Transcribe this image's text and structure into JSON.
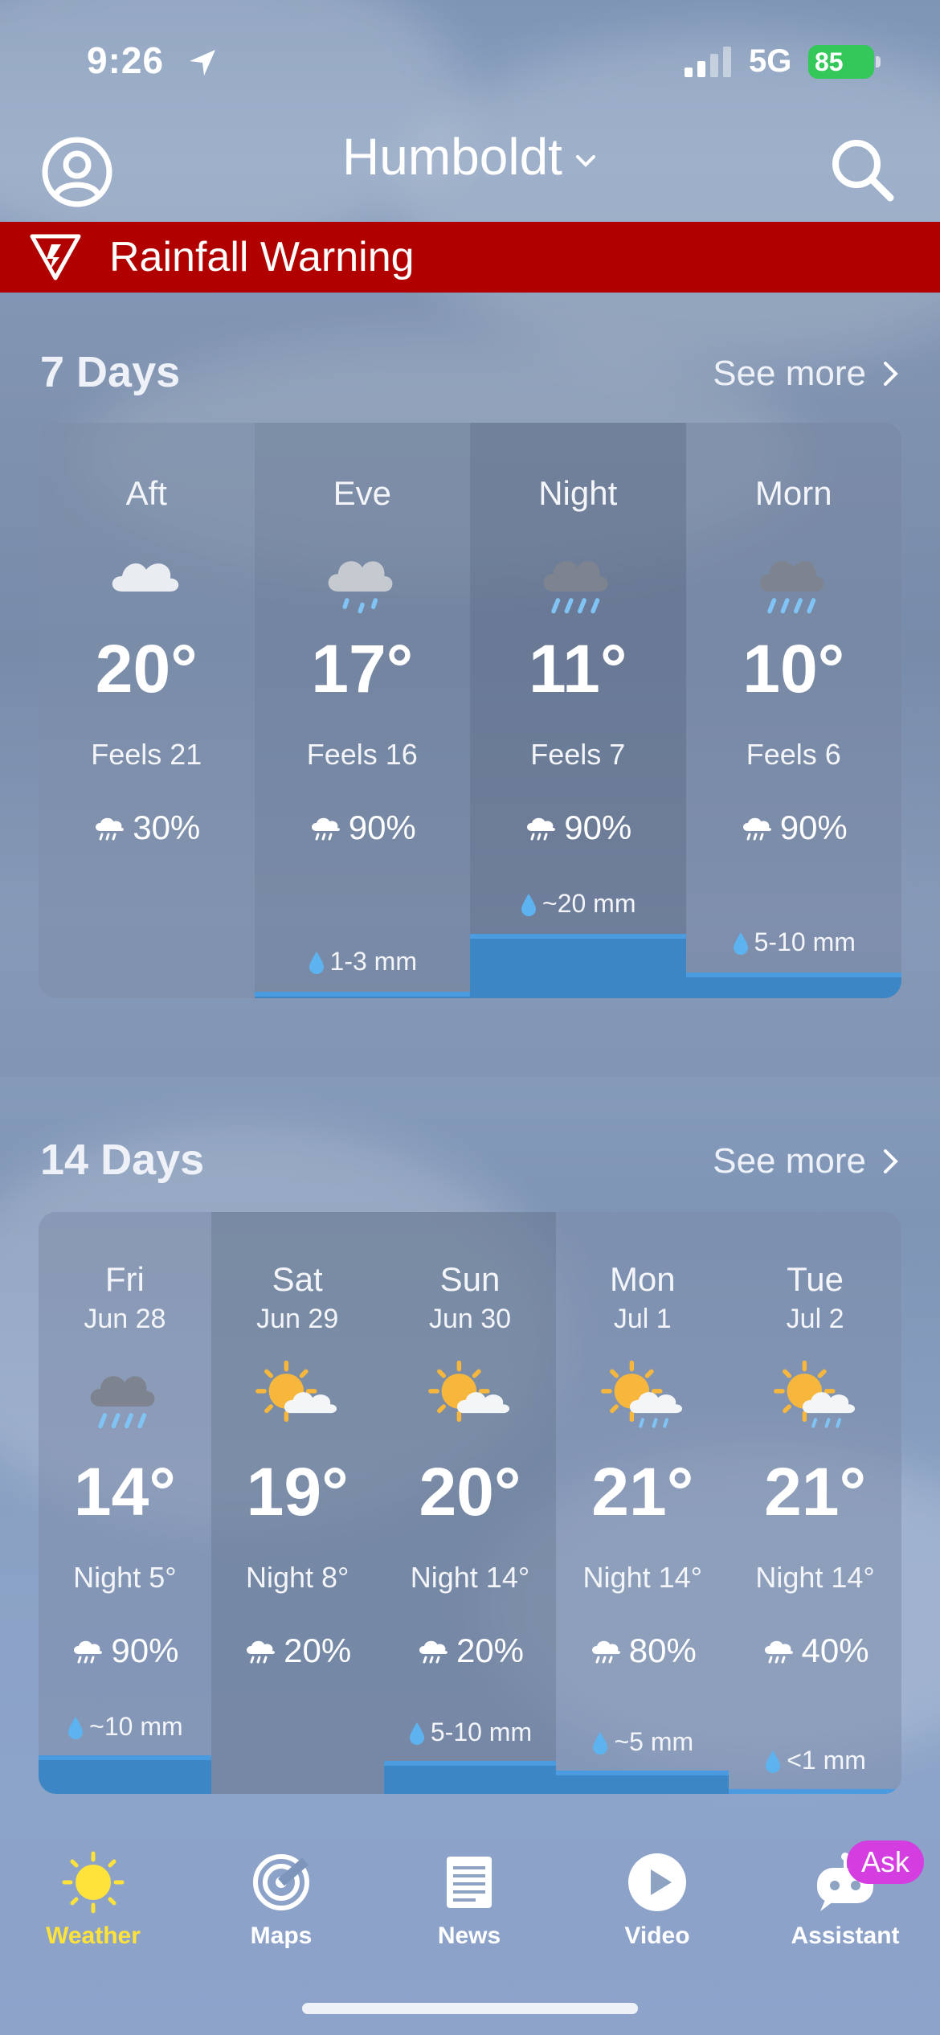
{
  "status_bar": {
    "time": "9:26",
    "network": "5G",
    "battery": "85"
  },
  "header": {
    "location": "Humboldt",
    "profile_icon": "profile-icon",
    "search_icon": "search-icon"
  },
  "warning": {
    "text": "Rainfall Warning",
    "color": "#b00000"
  },
  "seven_days": {
    "title": "7 Days",
    "see_more": "See more",
    "periods": [
      {
        "label": "Aft",
        "icon": "cloudy",
        "temp": "20°",
        "feels": "Feels 21",
        "pop": "30%",
        "rain": "",
        "rain_level": 0
      },
      {
        "label": "Eve",
        "icon": "light-rain",
        "temp": "17°",
        "feels": "Feels 16",
        "pop": "90%",
        "rain": "1-3 mm",
        "rain_level": 0.1
      },
      {
        "label": "Night",
        "icon": "rain",
        "temp": "11°",
        "feels": "Feels 7",
        "pop": "90%",
        "rain": "~20 mm",
        "rain_level": 1.0
      },
      {
        "label": "Morn",
        "icon": "rain",
        "temp": "10°",
        "feels": "Feels 6",
        "pop": "90%",
        "rain": "5-10 mm",
        "rain_level": 0.4
      }
    ]
  },
  "fourteen_days": {
    "title": "14 Days",
    "see_more": "See more",
    "days": [
      {
        "day": "Fri",
        "date": "Jun 28",
        "icon": "rain",
        "temp": "14°",
        "night": "Night 5°",
        "pop": "90%",
        "rain": "~10 mm",
        "rain_level": 1.0
      },
      {
        "day": "Sat",
        "date": "Jun 29",
        "icon": "sun-cloud",
        "temp": "19°",
        "night": "Night 8°",
        "pop": "20%",
        "rain": "",
        "rain_level": 0
      },
      {
        "day": "Sun",
        "date": "Jun 30",
        "icon": "sun-cloud",
        "temp": "20°",
        "night": "Night 14°",
        "pop": "20%",
        "rain": "5-10 mm",
        "rain_level": 0.85
      },
      {
        "day": "Mon",
        "date": "Jul 1",
        "icon": "sun-cloud-rain",
        "temp": "21°",
        "night": "Night 14°",
        "pop": "80%",
        "rain": "~5 mm",
        "rain_level": 0.6
      },
      {
        "day": "Tue",
        "date": "Jul 2",
        "icon": "sun-cloud-rain",
        "temp": "21°",
        "night": "Night 14°",
        "pop": "40%",
        "rain": "<1 mm",
        "rain_level": 0.1
      }
    ]
  },
  "bottom_nav": {
    "items": [
      {
        "label": "Weather",
        "icon": "sun-icon",
        "active": true
      },
      {
        "label": "Maps",
        "icon": "radar-icon",
        "active": false
      },
      {
        "label": "News",
        "icon": "newspaper-icon",
        "active": false
      },
      {
        "label": "Video",
        "icon": "play-icon",
        "active": false
      },
      {
        "label": "Assistant",
        "icon": "robot-icon",
        "active": false
      }
    ],
    "ask_badge": "Ask"
  }
}
